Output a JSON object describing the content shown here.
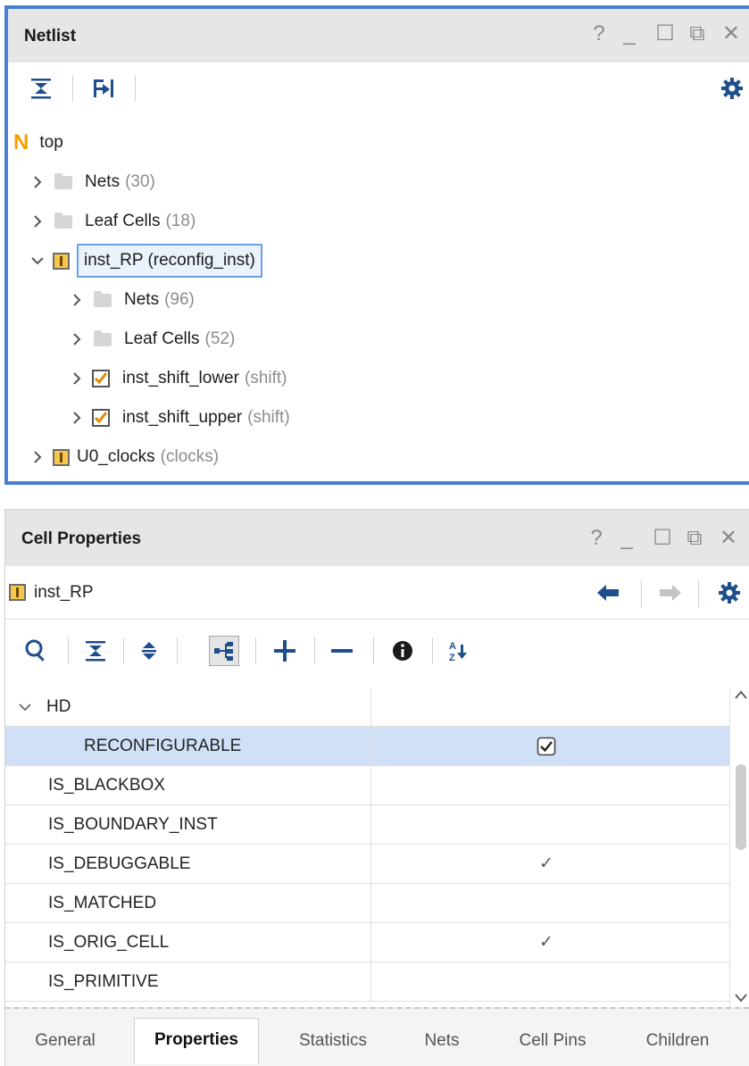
{
  "netlist": {
    "title": "Netlist",
    "window_controls": [
      "?",
      "_",
      "☐",
      "⧉",
      "✕"
    ],
    "toolbar": [
      "collapse-all-icon",
      "expand-hierarchy-icon",
      "gear-icon"
    ],
    "root": {
      "badge": "N",
      "label": "top"
    },
    "tree": [
      {
        "label": "Nets",
        "count": "(30)"
      },
      {
        "label": "Leaf Cells",
        "count": "(18)"
      },
      {
        "label": "inst_RP (reconfig_inst)"
      },
      {
        "label": "Nets",
        "count": "(96)"
      },
      {
        "label": "Leaf Cells",
        "count": "(52)"
      },
      {
        "label": "inst_shift_lower",
        "ref": "(shift)"
      },
      {
        "label": "inst_shift_upper",
        "ref": "(shift)"
      },
      {
        "label": "U0_clocks",
        "ref": "(clocks)"
      }
    ]
  },
  "properties": {
    "title": "Cell Properties",
    "window_controls": [
      "?",
      "_",
      "☐",
      "⧉",
      "✕"
    ],
    "object": "inst_RP",
    "toolbar": [
      "search-icon",
      "collapse-all-icon",
      "expand-all-icon",
      "show-hierarchy-icon",
      "add-icon",
      "remove-icon",
      "info-icon",
      "sort-az-icon"
    ],
    "rows": [
      {
        "name": "HD"
      },
      {
        "name": "RECONFIGURABLE",
        "value": "checkbox-checked"
      },
      {
        "name": "IS_BLACKBOX"
      },
      {
        "name": "IS_BOUNDARY_INST"
      },
      {
        "name": "IS_DEBUGGABLE",
        "value": "✓"
      },
      {
        "name": "IS_MATCHED"
      },
      {
        "name": "IS_ORIG_CELL",
        "value": "✓"
      },
      {
        "name": "IS_PRIMITIVE"
      }
    ],
    "tabs": [
      "General",
      "Properties",
      "Statistics",
      "Nets",
      "Cell Pins",
      "Children"
    ],
    "active_tab": "Properties"
  },
  "colors": {
    "accent": "#4a7fd0",
    "selection": "#cfe0f7",
    "root_badge": "#f0a000"
  }
}
